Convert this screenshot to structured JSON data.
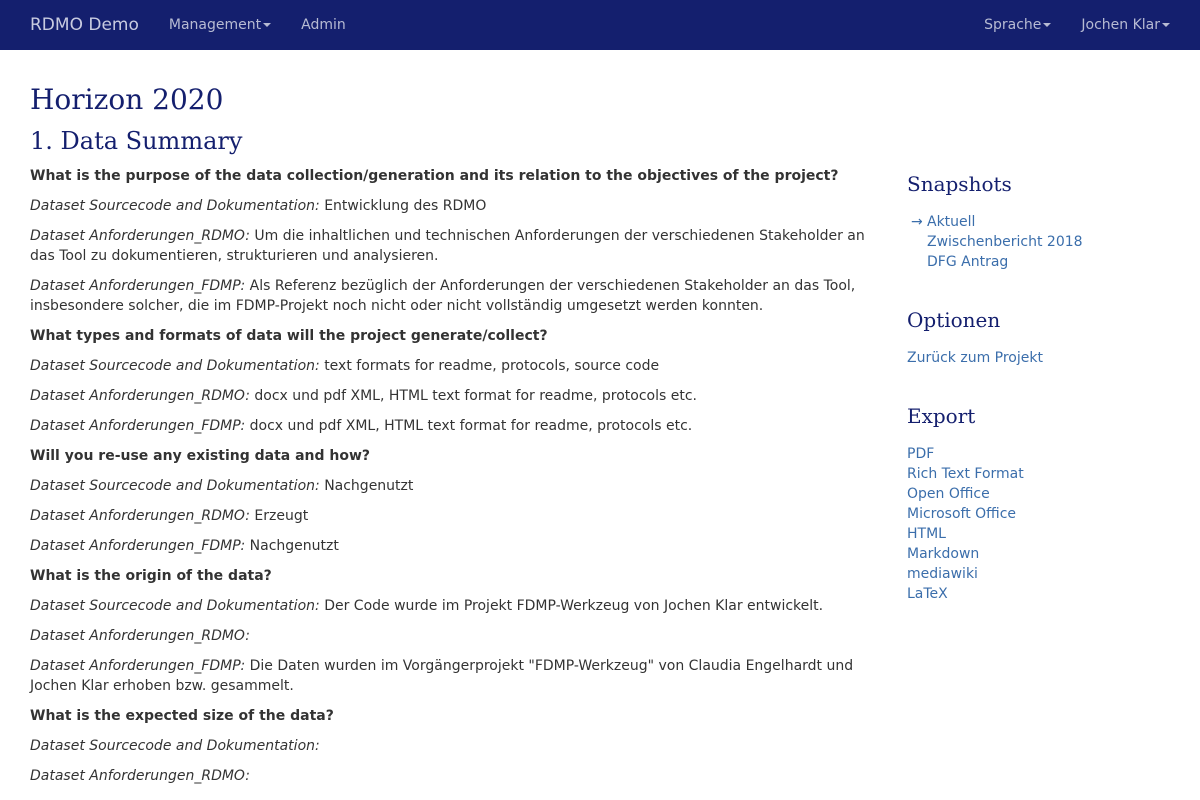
{
  "navbar": {
    "brand": "RDMO Demo",
    "management": "Management",
    "admin": "Admin",
    "language": "Sprache",
    "user": "Jochen Klar"
  },
  "page": {
    "title": "Horizon 2020",
    "section": "1. Data Summary"
  },
  "content": {
    "q1": "What is the purpose of the data collection/generation and its relation to the objectives of the project?",
    "q1a1_label": "Dataset Sourcecode and Dokumentation:",
    "q1a1_text": "Entwicklung des RDMO",
    "q1a2_label": "Dataset Anforderungen_RDMO:",
    "q1a2_text": "Um die inhaltlichen und technischen Anforderungen der verschiedenen Stakeholder an das Tool zu dokumentieren, strukturieren und analysieren.",
    "q1a3_label": "Dataset Anforderungen_FDMP:",
    "q1a3_text": "Als Referenz bezüglich der Anforderungen der verschiedenen Stakeholder an das Tool, insbesondere solcher, die im FDMP-Projekt noch nicht oder nicht vollständig umgesetzt werden konnten.",
    "q2": "What types and formats of data will the project generate/collect?",
    "q2a1_label": "Dataset Sourcecode and Dokumentation:",
    "q2a1_text": "text formats for readme, protocols, source code",
    "q2a2_label": "Dataset Anforderungen_RDMO:",
    "q2a2_text": "docx und pdf XML, HTML text format for readme, protocols etc.",
    "q2a3_label": "Dataset Anforderungen_FDMP:",
    "q2a3_text": "docx und pdf XML, HTML text format for readme, protocols etc.",
    "q3": "Will you re-use any existing data and how?",
    "q3a1_label": "Dataset Sourcecode and Dokumentation:",
    "q3a1_text": "Nachgenutzt",
    "q3a2_label": "Dataset Anforderungen_RDMO:",
    "q3a2_text": "Erzeugt",
    "q3a3_label": "Dataset Anforderungen_FDMP:",
    "q3a3_text": "Nachgenutzt",
    "q4": "What is the origin of the data?",
    "q4a1_label": "Dataset Sourcecode and Dokumentation:",
    "q4a1_text": "Der Code wurde im Projekt FDMP-Werkzeug von Jochen Klar entwickelt.",
    "q4a2_label": "Dataset Anforderungen_RDMO:",
    "q4a2_text": "",
    "q4a3_label": "Dataset Anforderungen_FDMP:",
    "q4a3_text": "Die Daten wurden im Vorgängerprojekt \"FDMP-Werkzeug\" von Claudia Engelhardt und Jochen Klar erhoben bzw. gesammelt.",
    "q5": "What is the expected size of the data?",
    "q5a1_label": "Dataset Sourcecode and Dokumentation:",
    "q5a1_text": "",
    "q5a2_label": "Dataset Anforderungen_RDMO:",
    "q5a2_text": ""
  },
  "sidebar": {
    "snapshots_title": "Snapshots",
    "snapshot_arrow": "→",
    "snap1": "Aktuell",
    "snap2": "Zwischenbericht 2018",
    "snap3": "DFG Antrag",
    "options_title": "Optionen",
    "back": "Zurück zum Projekt",
    "export_title": "Export",
    "exp1": "PDF",
    "exp2": "Rich Text Format",
    "exp3": "Open Office",
    "exp4": "Microsoft Office",
    "exp5": "HTML",
    "exp6": "Markdown",
    "exp7": "mediawiki",
    "exp8": "LaTeX"
  }
}
